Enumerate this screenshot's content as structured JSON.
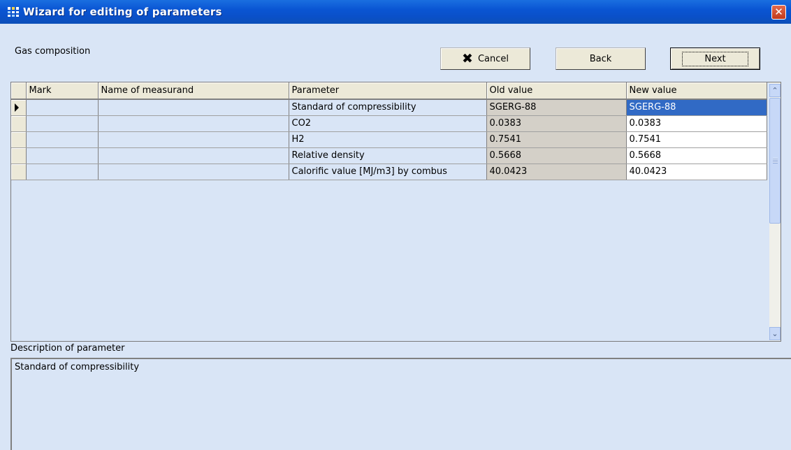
{
  "window": {
    "title": "Wizard for editing  of parameters",
    "close_glyph": "✕",
    "icon": "grid-app-icon"
  },
  "toolbar": {
    "section_label": "Gas composition",
    "cancel_label": "Cancel",
    "cancel_icon_glyph": "✖",
    "back_label": "Back",
    "next_label": "Next"
  },
  "grid": {
    "columns": [
      "Mark",
      "Name of measurand",
      "Parameter",
      "Old value",
      "New value"
    ],
    "rows": [
      {
        "mark": "",
        "name": "",
        "parameter": "Standard of compressibility",
        "old": "SGERG-88",
        "new": "SGERG-88"
      },
      {
        "mark": "",
        "name": "",
        "parameter": "CO2",
        "old": "0.0383",
        "new": "0.0383"
      },
      {
        "mark": "",
        "name": "",
        "parameter": "H2",
        "old": "0.7541",
        "new": "0.7541"
      },
      {
        "mark": "",
        "name": "",
        "parameter": "Relative density",
        "old": "0.5668",
        "new": "0.5668"
      },
      {
        "mark": "",
        "name": "",
        "parameter": "Calorific value [MJ/m3] by combus",
        "old": "40.0423",
        "new": "40.0423"
      }
    ],
    "selected_row": 0
  },
  "scrollbar": {
    "up_glyph": "⌃",
    "down_glyph": "⌄"
  },
  "description": {
    "label": "Description of parameter",
    "text": "Standard of compressibility"
  },
  "colors": {
    "titlebar": "#0a55d3",
    "background": "#d9e5f6",
    "selection": "#316ac5"
  }
}
